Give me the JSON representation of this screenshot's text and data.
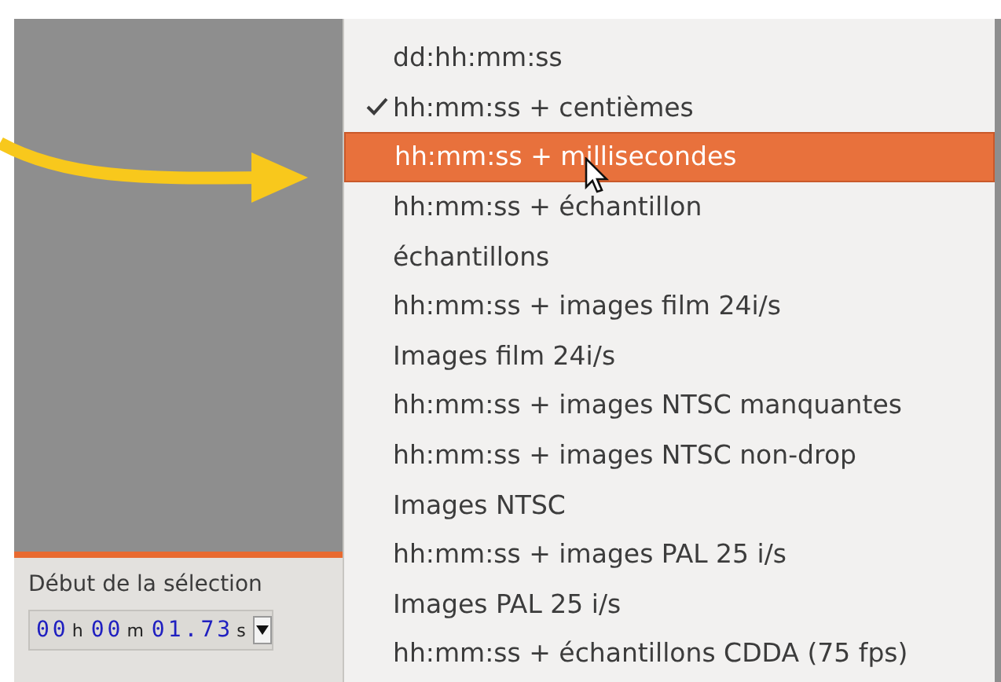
{
  "selection_panel": {
    "label": "Début de la sélection",
    "time": [
      {
        "digits": "00",
        "unit": "h"
      },
      {
        "digits": "00",
        "unit": "m"
      },
      {
        "digits": "01.73",
        "unit": "s"
      }
    ]
  },
  "format_menu": {
    "items": [
      {
        "label": "dd:hh:mm:ss",
        "checked": false,
        "selected": false
      },
      {
        "label": "hh:mm:ss + centièmes",
        "checked": true,
        "selected": false
      },
      {
        "label": "hh:mm:ss + millisecondes",
        "checked": false,
        "selected": true
      },
      {
        "label": "hh:mm:ss + échantillon",
        "checked": false,
        "selected": false
      },
      {
        "label": "échantillons",
        "checked": false,
        "selected": false
      },
      {
        "label": "hh:mm:ss + images film 24i/s",
        "checked": false,
        "selected": false
      },
      {
        "label": "Images film 24i/s",
        "checked": false,
        "selected": false
      },
      {
        "label": "hh:mm:ss + images NTSC manquantes",
        "checked": false,
        "selected": false
      },
      {
        "label": "hh:mm:ss + images NTSC non-drop",
        "checked": false,
        "selected": false
      },
      {
        "label": "Images NTSC",
        "checked": false,
        "selected": false
      },
      {
        "label": "hh:mm:ss + images PAL 25 i/s",
        "checked": false,
        "selected": false
      },
      {
        "label": "Images PAL 25 i/s",
        "checked": false,
        "selected": false
      },
      {
        "label": "hh:mm:ss + échantillons CDDA (75 fps)",
        "checked": false,
        "selected": false
      }
    ]
  }
}
